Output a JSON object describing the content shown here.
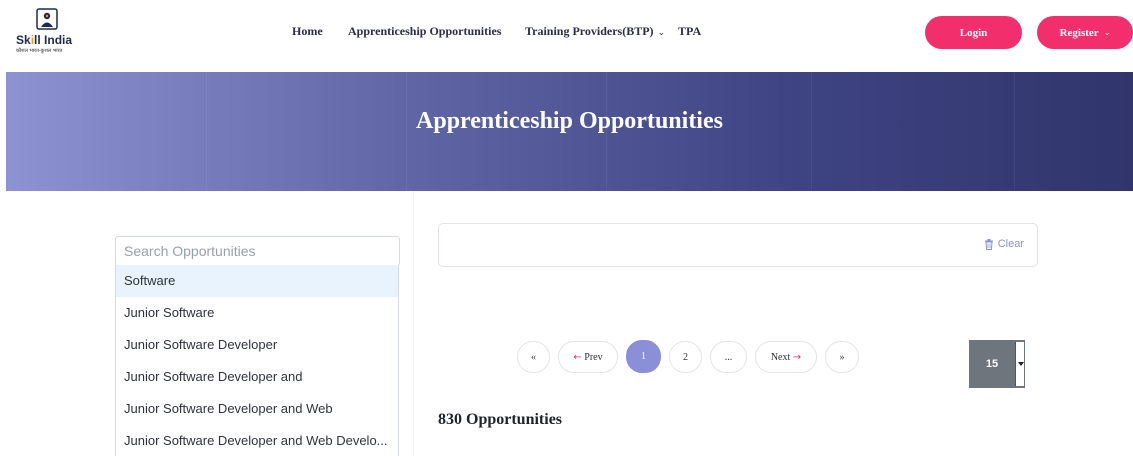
{
  "brand": {
    "name_prefix": "Sk",
    "name_dot": "i",
    "name_suffix": "ll India",
    "tagline": "कौशल भारत-कुशल भारत"
  },
  "nav": {
    "home": "Home",
    "apprenticeship": "Apprenticeship Opportunities",
    "training_providers": "Training Providers(BTP)",
    "tpa": "TPA"
  },
  "auth": {
    "login": "Login",
    "register": "Register"
  },
  "banner": {
    "title": "Apprenticeship Opportunities"
  },
  "search": {
    "placeholder": "Search Opportunities",
    "suggestions": [
      "Software",
      "Junior Software",
      "Junior Software Developer",
      "Junior Software Developer and",
      "Junior Software Developer and Web",
      "Junior Software Developer and Web Develo..."
    ],
    "active_index": 0
  },
  "filters": {
    "clear_label": "Clear"
  },
  "pagination": {
    "first": "«",
    "prev": "Prev",
    "pages": [
      "1",
      "2",
      "..."
    ],
    "current": "1",
    "next": "Next",
    "last": "»",
    "arrow_left": "←",
    "arrow_right": "→"
  },
  "page_size": {
    "selected": "15"
  },
  "results": {
    "count_label": "830 Opportunities"
  },
  "colors": {
    "accent_pink": "#f22e6d",
    "accent_purple": "#8a8fd8",
    "banner_dark": "#31356c"
  }
}
